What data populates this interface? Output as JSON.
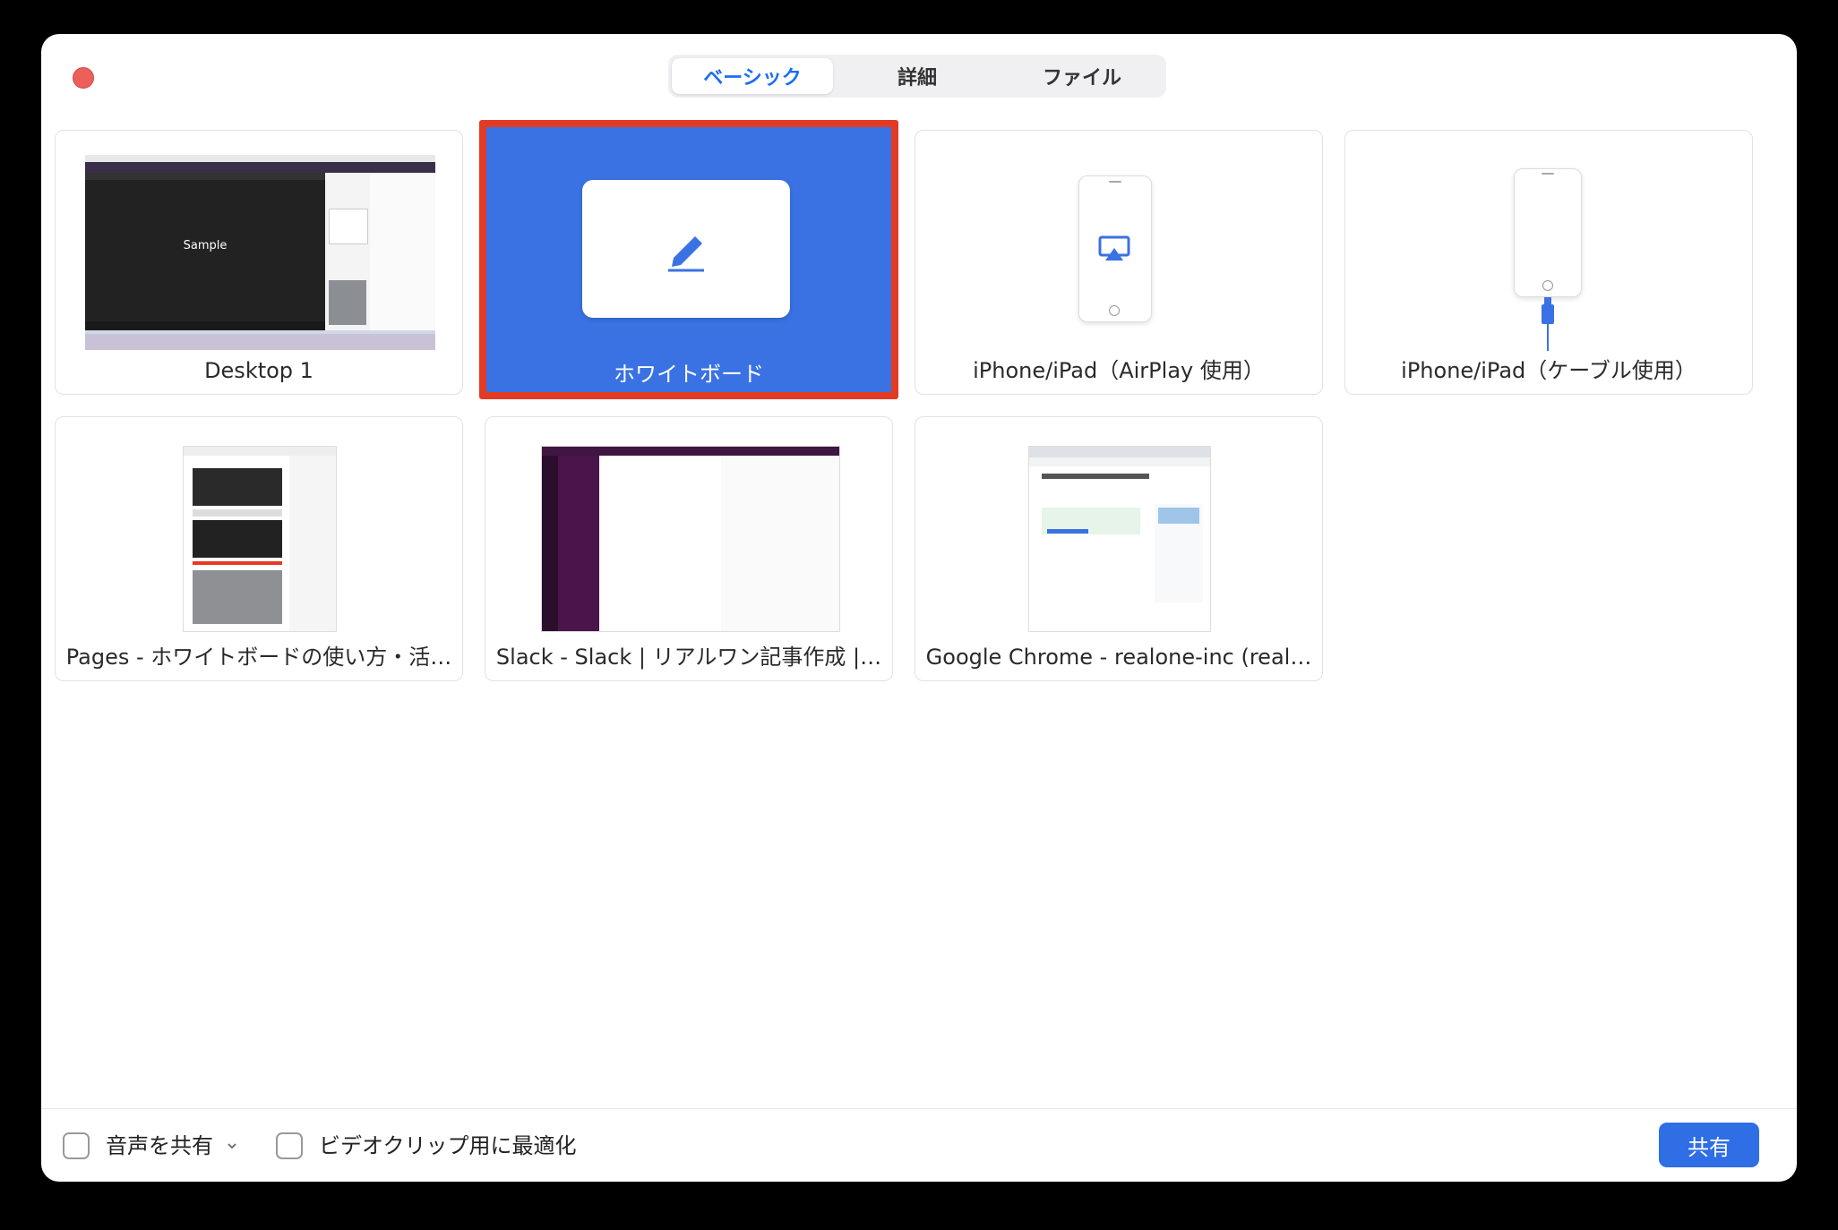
{
  "tabs": [
    {
      "label": "ベーシック",
      "active": true
    },
    {
      "label": "詳細",
      "active": false
    },
    {
      "label": "ファイル",
      "active": false
    }
  ],
  "items": [
    {
      "label": "Desktop 1",
      "thumb_text": "Sample"
    },
    {
      "label": "ホワイトボード",
      "selected": true
    },
    {
      "label": "iPhone/iPad（AirPlay 使用）"
    },
    {
      "label": "iPhone/iPad（ケーブル使用）"
    },
    {
      "label": "Pages - ホワイトボードの使い方・活…"
    },
    {
      "label": "Slack - Slack | リアルワン記事作成 |…"
    },
    {
      "label": "Google Chrome - realone-inc (real…"
    }
  ],
  "footer": {
    "share_audio_label": "音声を共有",
    "optimize_video_label": "ビデオクリップ用に最適化",
    "share_button_label": "共有"
  },
  "icons": {
    "close": "close-icon",
    "whiteboard": "pencil-icon",
    "airplay": "airplay-icon",
    "cable": "lightning-cable-icon",
    "dropdown": "chevron-down-icon"
  },
  "colors": {
    "accent": "#2f6ee4",
    "selected_border": "#e33b23",
    "whiteboard_bg": "#3a72e3"
  }
}
